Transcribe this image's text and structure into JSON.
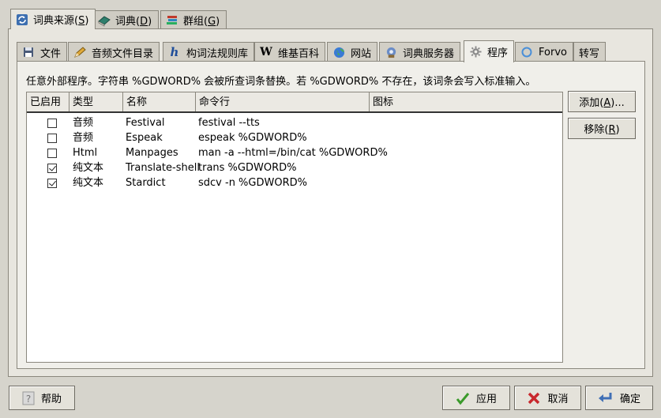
{
  "top_tabs": [
    {
      "label": "词典来源(",
      "mnemonic": "S",
      "suffix": ")",
      "icon": "refresh-icon",
      "active": true
    },
    {
      "label": "词典(",
      "mnemonic": "D",
      "suffix": ")",
      "icon": "book-icon",
      "active": false
    },
    {
      "label": "群组(",
      "mnemonic": "G",
      "suffix": ")",
      "icon": "books-stack-icon",
      "active": false
    }
  ],
  "inner_tabs": [
    {
      "label": "文件",
      "icon": "disk-icon"
    },
    {
      "label": "音频文件目录",
      "icon": "pencil-icon"
    },
    {
      "label": "构词法规则库",
      "icon": "h-icon"
    },
    {
      "label": "维基百科",
      "icon": "wikipedia-icon"
    },
    {
      "label": "网站",
      "icon": "globe-icon"
    },
    {
      "label": "词典服务器",
      "icon": "server-icon"
    },
    {
      "label": "程序",
      "icon": "gear-icon",
      "active": true
    },
    {
      "label": "Forvo",
      "icon": "forvo-icon"
    },
    {
      "label": "转写",
      "icon": ""
    }
  ],
  "programs": {
    "description": "任意外部程序。字符串 %GDWORD% 会被所查词条替换。若 %GDWORD% 不存在，该词条会写入标准输入。",
    "columns": {
      "enabled": "已启用",
      "type": "类型",
      "name": "名称",
      "command": "命令行",
      "icon": "图标"
    },
    "rows": [
      {
        "enabled": false,
        "type": "音频",
        "name": "Festival",
        "command": "festival --tts",
        "icon": ""
      },
      {
        "enabled": false,
        "type": "音频",
        "name": "Espeak",
        "command": "espeak %GDWORD%",
        "icon": ""
      },
      {
        "enabled": false,
        "type": "Html",
        "name": "Manpages",
        "command": "man -a --html=/bin/cat %GDWORD%",
        "icon": ""
      },
      {
        "enabled": true,
        "type": "纯文本",
        "name": "Translate-shell",
        "command": "trans %GDWORD%",
        "icon": ""
      },
      {
        "enabled": true,
        "type": "纯文本",
        "name": "Stardict",
        "command": "sdcv -n %GDWORD%",
        "icon": ""
      }
    ],
    "add_button": {
      "label": "添加(",
      "mnemonic": "A",
      "suffix": ")..."
    },
    "remove_button": {
      "label": "移除(",
      "mnemonic": "R",
      "suffix": ")"
    }
  },
  "footer": {
    "help": "帮助",
    "apply": "应用",
    "cancel": "取消",
    "ok": "确定"
  },
  "colors": {
    "window_bg": "#d6d4cc",
    "pane_bg": "#f0efea",
    "border": "#8a877d",
    "cancel_red": "#c8282d",
    "apply_green": "#3a9a2a",
    "ok_blue": "#3f6fb5"
  }
}
